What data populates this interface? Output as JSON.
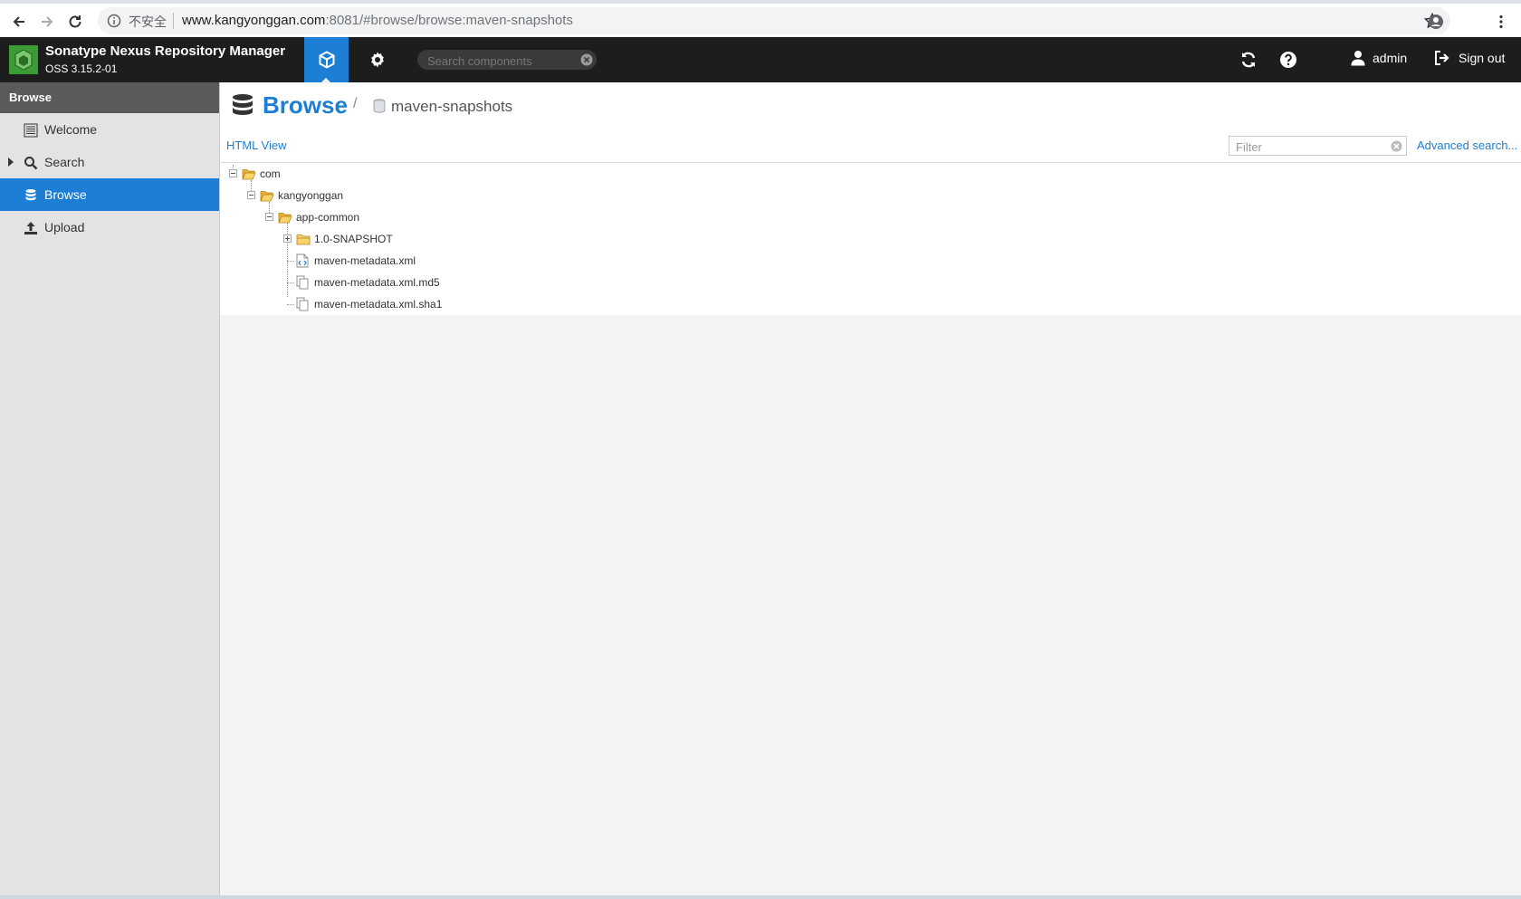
{
  "browser": {
    "security_label": "不安全",
    "url_host": "www.kangyonggan.com",
    "url_rest": ":8081/#browse/browse:maven-snapshots"
  },
  "header": {
    "app_name": "Sonatype Nexus Repository Manager",
    "version": "OSS 3.15.2-01",
    "search_placeholder": "Search components",
    "user": "admin",
    "sign_out": "Sign out"
  },
  "sidebar": {
    "title": "Browse",
    "items": [
      {
        "label": "Welcome",
        "icon": "list-icon"
      },
      {
        "label": "Search",
        "icon": "search-icon"
      },
      {
        "label": "Browse",
        "icon": "database-icon"
      },
      {
        "label": "Upload",
        "icon": "upload-icon"
      }
    ]
  },
  "main": {
    "breadcrumb_title": "Browse",
    "breadcrumb_sep": "/",
    "repository": "maven-snapshots",
    "html_view": "HTML View",
    "filter_placeholder": "Filter",
    "advanced_search": "Advanced search..."
  },
  "tree": [
    {
      "label": "com",
      "type": "folder",
      "expanded": true
    },
    {
      "label": "kangyonggan",
      "type": "folder",
      "expanded": true
    },
    {
      "label": "app-common",
      "type": "folder",
      "expanded": true
    },
    {
      "label": "1.0-SNAPSHOT",
      "type": "folder",
      "expanded": false
    },
    {
      "label": "maven-metadata.xml",
      "type": "xml-file"
    },
    {
      "label": "maven-metadata.xml.md5",
      "type": "file"
    },
    {
      "label": "maven-metadata.xml.sha1",
      "type": "file"
    }
  ],
  "colors": {
    "accent": "#1c7fd5",
    "header_bg": "#1d1d1d",
    "sidebar_bg": "#e3e3e3",
    "folder": "#f4c542"
  }
}
